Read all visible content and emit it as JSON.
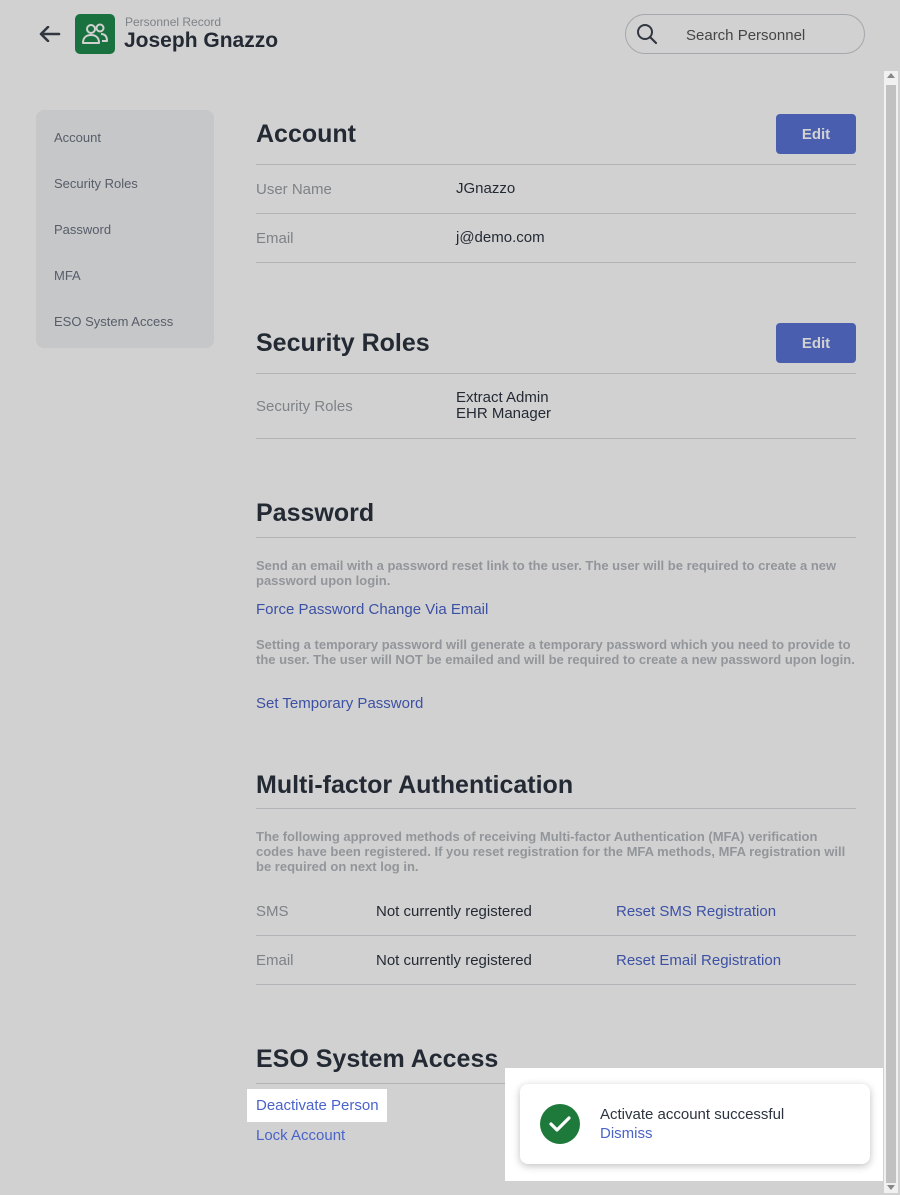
{
  "header": {
    "kicker": "Personnel Record",
    "name": "Joseph Gnazzo",
    "search_placeholder": "Search Personnel"
  },
  "sidenav": {
    "items": [
      {
        "label": "Account"
      },
      {
        "label": "Security Roles"
      },
      {
        "label": "Password"
      },
      {
        "label": "MFA"
      },
      {
        "label": "ESO System Access"
      }
    ]
  },
  "account": {
    "title": "Account",
    "edit_label": "Edit",
    "fields": [
      {
        "label": "User Name",
        "value": "JGnazzo"
      },
      {
        "label": "Email",
        "value": "j@demo.com"
      }
    ]
  },
  "security_roles": {
    "title": "Security Roles",
    "edit_label": "Edit",
    "label": "Security Roles",
    "roles": [
      "Extract Admin",
      "EHR Manager"
    ]
  },
  "password": {
    "title": "Password",
    "reset_desc": "Send an email with a password reset link to the user. The user will be required to create a new password upon login.",
    "reset_link": "Force Password Change Via Email",
    "temp_desc": "Setting a temporary password will generate a temporary password which you need to provide to the user. The user will NOT be emailed and will be required to create a new password upon login.",
    "temp_link": "Set Temporary Password"
  },
  "mfa": {
    "title": "Multi-factor Authentication",
    "desc": "The following approved methods of receiving Multi-factor Authentication (MFA) verification codes have been registered. If you reset registration for the MFA methods, MFA registration will be required on next log in.",
    "rows": [
      {
        "method": "SMS",
        "status": "Not currently registered",
        "action": "Reset SMS Registration"
      },
      {
        "method": "Email",
        "status": "Not currently registered",
        "action": "Reset Email Registration"
      }
    ]
  },
  "eso": {
    "title": "ESO System Access",
    "deactivate_link": "Deactivate Person",
    "lock_link": "Lock Account"
  },
  "toast": {
    "message": "Activate account successful",
    "dismiss": "Dismiss"
  },
  "colors": {
    "accent": "#5a73d6",
    "link": "#4a63c9",
    "success": "#1e7a3a",
    "app_icon": "#1e8a4c"
  }
}
